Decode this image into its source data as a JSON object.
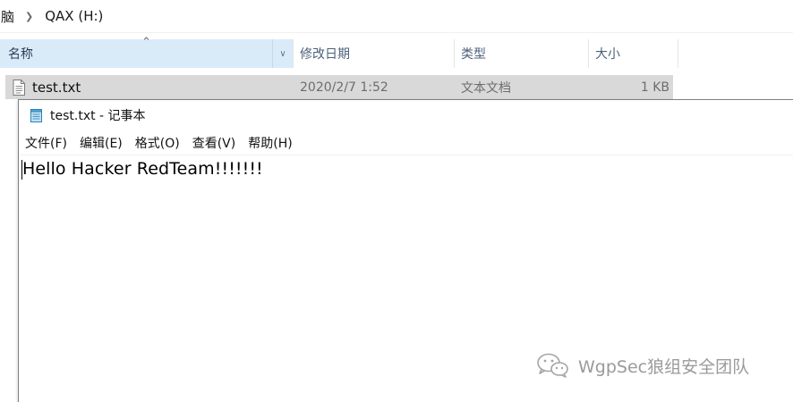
{
  "explorer": {
    "breadcrumb": {
      "parent": "脑",
      "current": "QAX (H:)"
    },
    "columns": {
      "name": "名称",
      "date_modified": "修改日期",
      "type": "类型",
      "size": "大小"
    },
    "files": [
      {
        "name": "test.txt",
        "date_modified": "2020/2/7 1:52",
        "type": "文本文档",
        "size": "1 KB",
        "icon": "text-file-icon"
      }
    ]
  },
  "notepad": {
    "title": "test.txt - 记事本",
    "icon": "notepad-icon",
    "menu": [
      "文件(F)",
      "编辑(E)",
      "格式(O)",
      "查看(V)",
      "帮助(H)"
    ],
    "content": "Hello Hacker RedTeam!!!!!!!"
  },
  "watermark": {
    "text": "WgpSec狼组安全团队",
    "icon": "wechat-icon"
  },
  "colors": {
    "header_selected_bg": "#d9ebf9",
    "row_selected_bg": "#d9d9d9",
    "header_text": "#4c607a",
    "secondary_text": "#6d6d6d",
    "watermark_text": "#9a9a9a"
  }
}
